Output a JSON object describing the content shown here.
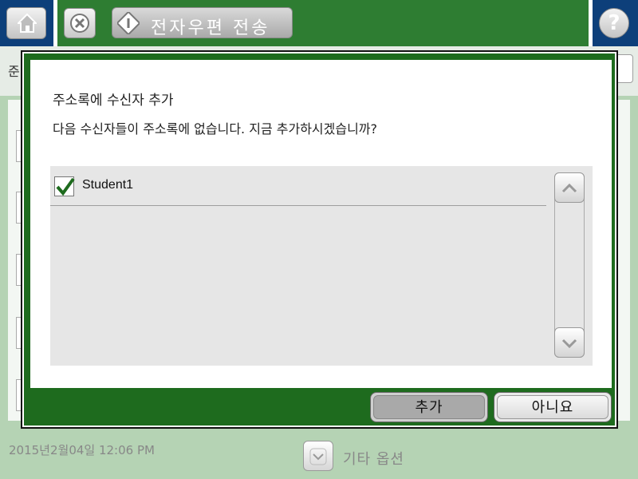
{
  "header": {
    "home_icon": "home-icon",
    "cancel_icon": "cancel-icon",
    "start_icon": "start-icon",
    "send_label": "전자우편 전송",
    "help_icon": "help-icon",
    "help_glyph": "?"
  },
  "background": {
    "partial_label": "준",
    "timestamp": "2015년2월04일 12:06 PM",
    "more_options_label": "기타 옵션",
    "more_options_icon": "chevron-down-icon"
  },
  "dialog": {
    "title": "주소록에 수신자 추가",
    "message": "다음 수신자들이 주소록에 없습니다. 지금 추가하시겠습니까?",
    "recipients": [
      {
        "label": "Student1",
        "checked": true
      }
    ],
    "scroll_up_icon": "chevron-up-icon",
    "scroll_down_icon": "chevron-down-icon",
    "add_button": "추가",
    "no_button": "아니요"
  },
  "colors": {
    "header_green": "#2e7d32",
    "header_blue": "#0d3f7a",
    "dialog_green": "#1e6b1e",
    "check_green": "#1e6b1e",
    "background_green": "#b5d3b4"
  }
}
